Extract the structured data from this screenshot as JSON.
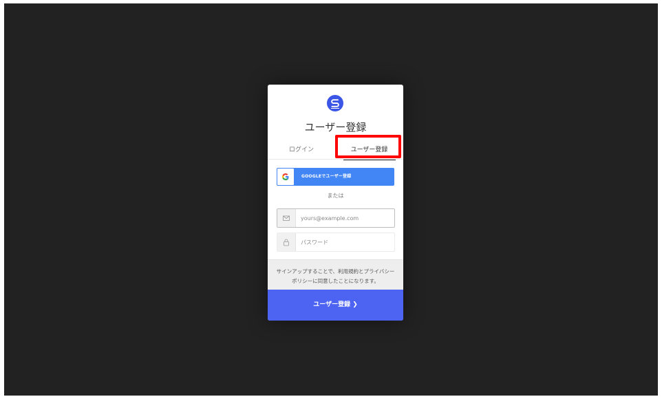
{
  "card": {
    "title": "ユーザー登録",
    "tabs": [
      {
        "label": "ログイン",
        "active": false
      },
      {
        "label": "ユーザー登録",
        "active": true
      }
    ],
    "google_button_label": "GOOGLEでユーザー登録",
    "separator": "または",
    "email": {
      "placeholder": "yours@example.com",
      "value": ""
    },
    "password": {
      "placeholder": "パスワード",
      "value": ""
    },
    "terms": {
      "line1": "サインアップすることで、利用規約とプライバシー",
      "line2": "ポリシーに同意したことになります。"
    },
    "submit_label": "ユーザー登録 ❯"
  },
  "colors": {
    "backdrop": "#222222",
    "accent": "#4d64f3",
    "google_blue": "#4285f4",
    "highlight": "#ff0000"
  }
}
